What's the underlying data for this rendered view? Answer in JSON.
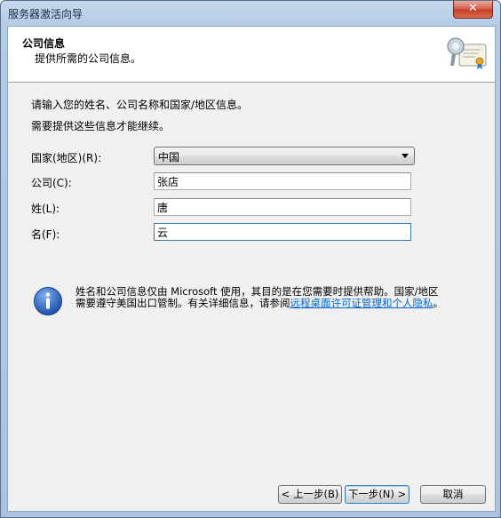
{
  "window": {
    "title": "服务器激活向导",
    "close_glyph": "✕"
  },
  "header": {
    "title": "公司信息",
    "subtitle": "提供所需的公司信息。",
    "icon": "certificate-icon"
  },
  "intro": {
    "line1": "请输入您的姓名、公司名称和国家/地区信息。",
    "line2": "需要提供这些信息才能继续。"
  },
  "form": {
    "country_label": "国家(地区)(R):",
    "country_value": "中国",
    "company_label": "公司(C):",
    "company_value": "张店",
    "last_name_label": "姓(L):",
    "last_name_value": "唐",
    "first_name_label": "名(F):",
    "first_name_value": "云"
  },
  "info": {
    "icon": "info-icon",
    "text_before_link": "姓名和公司信息仅由 Microsoft 使用，其目的是在您需要时提供帮助。国家/地区需要遵守美国出口管制。有关详细信息，请参阅",
    "link_text": "远程桌面许可证管理和个人隐私",
    "text_after_link": "。"
  },
  "buttons": {
    "back": "< 上一步(B)",
    "next": "下一步(N) >",
    "cancel": "取消"
  }
}
